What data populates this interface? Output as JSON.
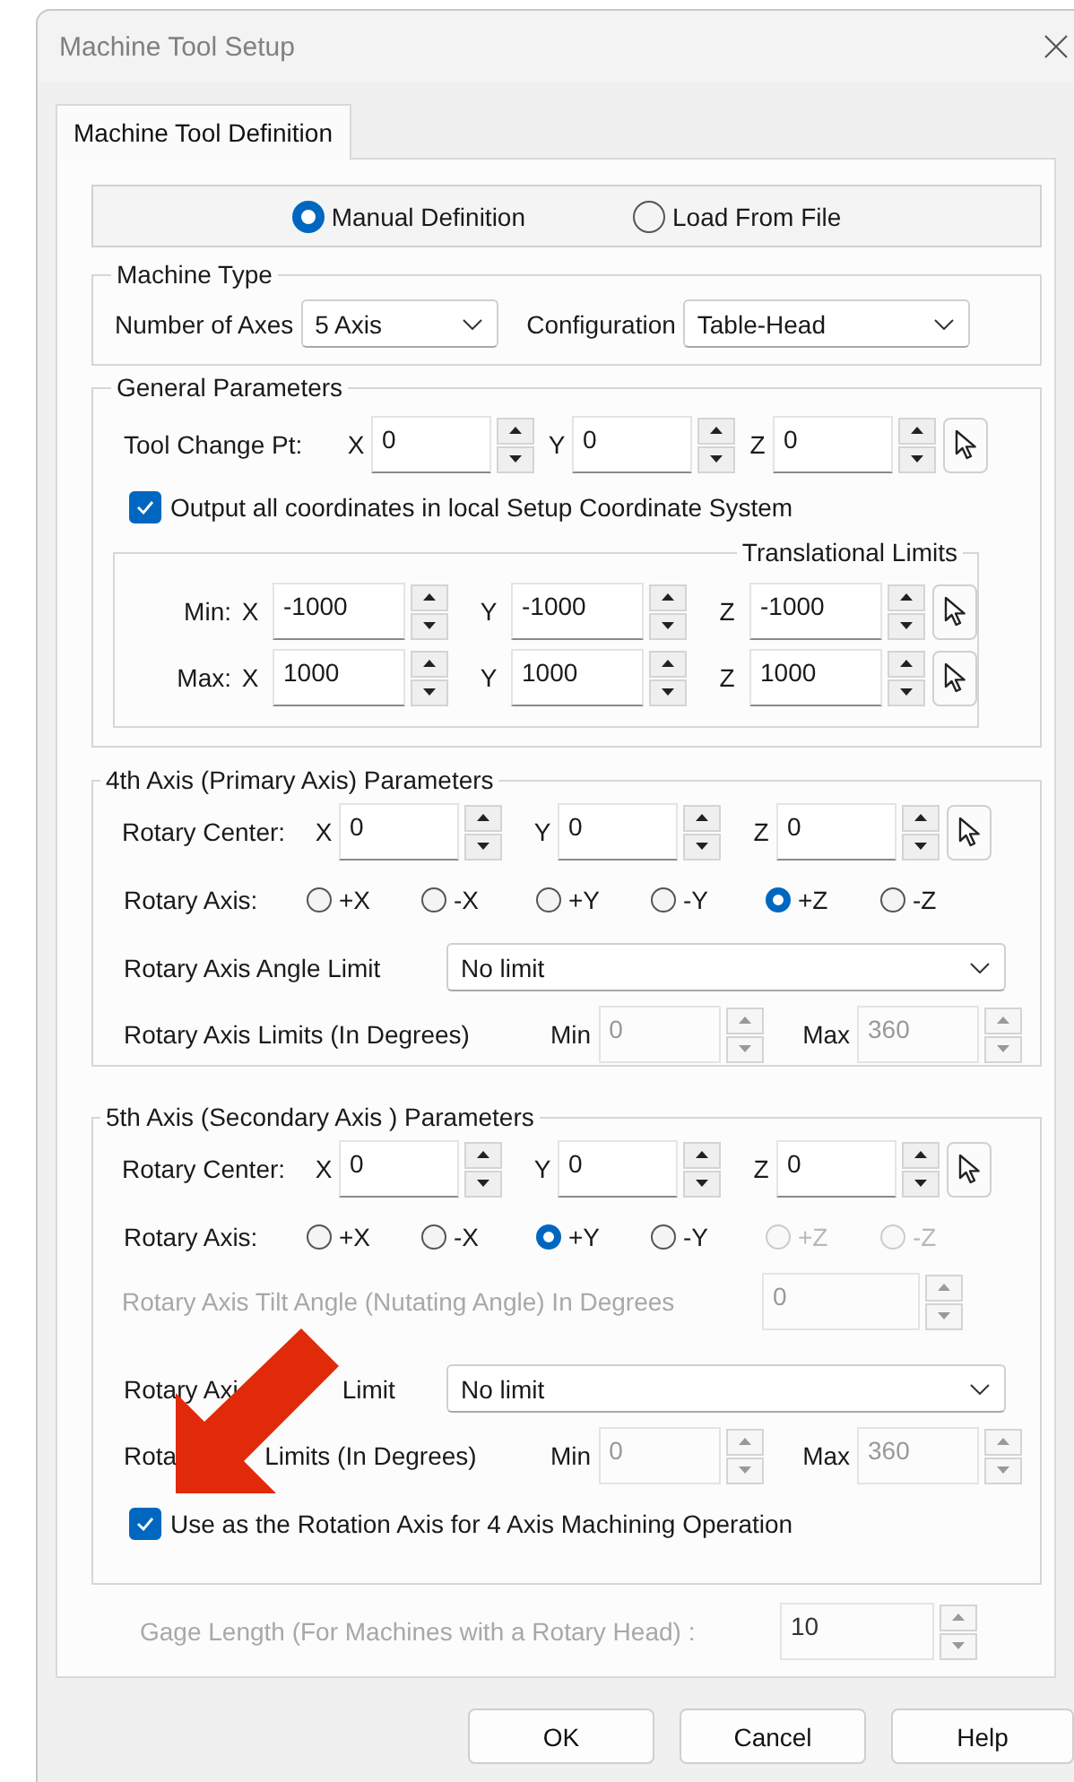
{
  "window": {
    "title": "Machine Tool Setup"
  },
  "tabs": [
    {
      "label": "Machine Tool Definition",
      "selected": true
    }
  ],
  "definition_mode": [
    {
      "label": "Manual Definition",
      "selected": true
    },
    {
      "label": "Load From File",
      "selected": false
    }
  ],
  "machine_type": {
    "title": "Machine Type",
    "fields": [
      {
        "label": "Number of Axes",
        "value": "5 Axis"
      },
      {
        "label": "Configuration",
        "value": "Table-Head"
      }
    ]
  },
  "general": {
    "title": "General Parameters",
    "tool_change": {
      "label": "Tool Change Pt:",
      "coords": [
        {
          "axis": "X",
          "value": "0"
        },
        {
          "axis": "Y",
          "value": "0"
        },
        {
          "axis": "Z",
          "value": "0"
        }
      ]
    },
    "output_local": {
      "label": "Output all coordinates in local Setup Coordinate System",
      "checked": true
    },
    "limits": {
      "title": "Translational Limits",
      "rows": [
        {
          "label": "Min:",
          "coords": [
            {
              "axis": "X",
              "value": "-1000"
            },
            {
              "axis": "Y",
              "value": "-1000"
            },
            {
              "axis": "Z",
              "value": "-1000"
            }
          ]
        },
        {
          "label": "Max:",
          "coords": [
            {
              "axis": "X",
              "value": "1000"
            },
            {
              "axis": "Y",
              "value": "1000"
            },
            {
              "axis": "Z",
              "value": "1000"
            }
          ]
        }
      ]
    }
  },
  "axis4": {
    "title": "4th Axis (Primary Axis) Parameters",
    "center": {
      "label": "Rotary Center:",
      "coords": [
        {
          "axis": "X",
          "value": "0"
        },
        {
          "axis": "Y",
          "value": "0"
        },
        {
          "axis": "Z",
          "value": "0"
        }
      ]
    },
    "rotary_axis": {
      "label": "Rotary Axis:",
      "options": [
        {
          "label": "+X",
          "selected": false,
          "disabled": false
        },
        {
          "label": "-X",
          "selected": false,
          "disabled": false
        },
        {
          "label": "+Y",
          "selected": false,
          "disabled": false
        },
        {
          "label": "-Y",
          "selected": false,
          "disabled": false
        },
        {
          "label": "+Z",
          "selected": true,
          "disabled": false
        },
        {
          "label": "-Z",
          "selected": false,
          "disabled": false
        }
      ]
    },
    "angle_limit": {
      "label_parts": [
        "Rotary Axis Angle Limit"
      ],
      "value": "No limit"
    },
    "limits": {
      "label_parts": [
        "Rotary Axis Limits (In Degrees)"
      ],
      "min_label": "Min",
      "min": "0",
      "max_label": "Max",
      "max": "360",
      "disabled": true
    }
  },
  "axis5": {
    "title": "5th Axis (Secondary Axis ) Parameters",
    "center": {
      "label": "Rotary Center:",
      "coords": [
        {
          "axis": "X",
          "value": "0"
        },
        {
          "axis": "Y",
          "value": "0"
        },
        {
          "axis": "Z",
          "value": "0"
        }
      ]
    },
    "rotary_axis": {
      "label": "Rotary Axis:",
      "options": [
        {
          "label": "+X",
          "selected": false,
          "disabled": false
        },
        {
          "label": "-X",
          "selected": false,
          "disabled": false
        },
        {
          "label": "+Y",
          "selected": true,
          "disabled": false
        },
        {
          "label": "-Y",
          "selected": false,
          "disabled": false
        },
        {
          "label": "+Z",
          "selected": false,
          "disabled": true
        },
        {
          "label": "-Z",
          "selected": false,
          "disabled": true
        }
      ]
    },
    "tilt": {
      "label": "Rotary Axis Tilt Angle (Nutating Angle) In Degrees",
      "value": "0",
      "disabled": true
    },
    "angle_limit": {
      "label_parts": [
        "Rotary Axi",
        "Limit"
      ],
      "value": "No limit"
    },
    "limits": {
      "label_parts": [
        "Rota",
        "Limits (In Degrees)"
      ],
      "min_label": "Min",
      "min": "0",
      "max_label": "Max",
      "max": "360",
      "disabled": true
    },
    "use_for_4axis": {
      "label": "Use as the Rotation Axis for 4 Axis Machining Operation",
      "checked": true
    }
  },
  "gage_length": {
    "label": "Gage Length (For Machines with a Rotary Head) :",
    "value": "10",
    "disabled": true
  },
  "buttons": [
    "OK",
    "Cancel",
    "Help"
  ]
}
